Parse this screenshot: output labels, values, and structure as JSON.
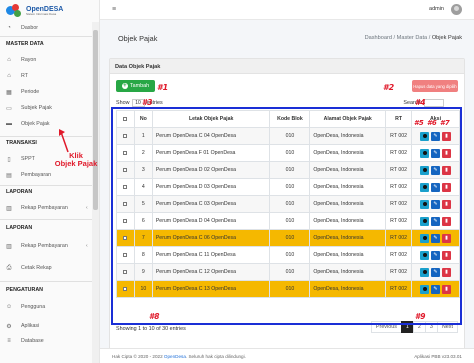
{
  "brand": {
    "name": "OpenDESA",
    "tagline": "Sistem Informasi Desa"
  },
  "sidebar": {
    "dashboard": "Dasbor",
    "sec_master": "MASTER DATA",
    "master_items": [
      "Rayon",
      "RT",
      "Periode",
      "Subjek Pajak",
      "Objek Pajak"
    ],
    "sec_transaksi": "TRANSAKSI",
    "transaksi_items": [
      "SPPT",
      "Pembayaran"
    ],
    "sec_laporan": "LAPORAN",
    "laporan_items": [
      "Rekap Pembayaran"
    ],
    "sec_laporan2": "LAPORAN",
    "laporan2_items": [
      "Rekap Pembayaran",
      "Cetak Rekap"
    ],
    "sec_pengaturan": "PENGATURAN",
    "pengaturan_items": [
      "Pengguna",
      "Aplikasi",
      "Database"
    ]
  },
  "annotations": {
    "klik": "Klik",
    "objek_pajak": "Objek Pajak",
    "n1": "#1",
    "n2": "#2",
    "n3": "#3",
    "n4": "#4",
    "n5": "#5",
    "n6": "#6",
    "n7": "#7",
    "n8": "#8",
    "n9": "#9"
  },
  "topbar": {
    "user": "admin"
  },
  "page": {
    "title": "Objek Pajak",
    "breadcrumb": [
      "Dashboard",
      "Master Data",
      "Objek Pajak"
    ],
    "sep": "/"
  },
  "card": {
    "title": "Data Objek Pajak",
    "add_label": "Tambah",
    "delete_selected_label": "Hapus data yang dipilih",
    "show_label": "Show",
    "show_value": "10",
    "entries_label": "entries",
    "search_label": "Search:",
    "search_value": ""
  },
  "table": {
    "headers": [
      "No",
      "Letak Objek Pajak",
      "Kode Blok",
      "Alamat Objek Pajak",
      "RT",
      "Aksi"
    ],
    "rows": [
      {
        "no": "1",
        "letak": "Perum OpenDesa C 04 OpenDesa",
        "kode": "010",
        "alamat": "OpenDesa, Indonesia",
        "rt": "RT 002",
        "highlight": false
      },
      {
        "no": "2",
        "letak": "Perum OpenDesa F 01 OpenDesa",
        "kode": "010",
        "alamat": "OpenDesa, Indonesia",
        "rt": "RT 002",
        "highlight": false
      },
      {
        "no": "3",
        "letak": "Perum OpenDesa D 02 OpenDesa",
        "kode": "010",
        "alamat": "OpenDesa, Indonesia",
        "rt": "RT 002",
        "highlight": false
      },
      {
        "no": "4",
        "letak": "Perum OpenDesa D 03 OpenDesa",
        "kode": "010",
        "alamat": "OpenDesa, Indonesia",
        "rt": "RT 002",
        "highlight": false
      },
      {
        "no": "5",
        "letak": "Perum OpenDesa C 03 OpenDesa",
        "kode": "010",
        "alamat": "OpenDesa, Indonesia",
        "rt": "RT 002",
        "highlight": false
      },
      {
        "no": "6",
        "letak": "Perum OpenDesa D 04 OpenDesa",
        "kode": "010",
        "alamat": "OpenDesa, Indonesia",
        "rt": "RT 002",
        "highlight": false
      },
      {
        "no": "7",
        "letak": "Perum OpenDesa C 06 OpenDesa",
        "kode": "010",
        "alamat": "OpenDesa, Indonesia",
        "rt": "RT 002",
        "highlight": true
      },
      {
        "no": "8",
        "letak": "Perum OpenDesa C 11 OpenDesa",
        "kode": "010",
        "alamat": "OpenDesa, Indonesia",
        "rt": "RT 002",
        "highlight": false
      },
      {
        "no": "9",
        "letak": "Perum OpenDesa C 12 OpenDesa",
        "kode": "010",
        "alamat": "OpenDesa, Indonesia",
        "rt": "RT 002",
        "highlight": false
      },
      {
        "no": "10",
        "letak": "Perum OpenDesa C 13 OpenDesa",
        "kode": "010",
        "alamat": "OpenDesa, Indonesia",
        "rt": "RT 002",
        "highlight": true
      }
    ]
  },
  "pagination": {
    "info": "Showing 1 to 10 of 30 entries",
    "previous": "Previous",
    "pages": [
      "1",
      "2",
      "3"
    ],
    "active_page": "1",
    "next": "Next"
  },
  "footer": {
    "copyright_prefix": "Hak Cipta © 2020 - 2022",
    "copyright_link": "OpenDesa",
    "copyright_suffix": ". Seluruh hak cipta dilindungi.",
    "version": "Aplikasi PBB v23.03.01"
  },
  "colors": {
    "accent": "#28a745",
    "annotation": "#e0192a",
    "frame": "#1a2fd6",
    "highlight_row": "#f5b800"
  }
}
